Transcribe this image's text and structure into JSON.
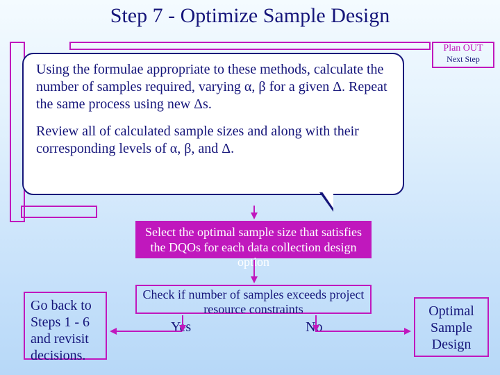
{
  "title": "Step 7 - Optimize Sample Design",
  "plan_out": {
    "label": "Plan OUT",
    "sublabel": "Next Step"
  },
  "callout": {
    "p1": "Using the formulae appropriate to these methods, calculate the number of samples required, varying α, β for a given Δ. Repeat the same process using new Δs.",
    "p2": "Review all of calculated sample sizes and along with their corresponding levels of  α, β, and Δ."
  },
  "select_box": "Select the optimal sample size that satisfies the DQOs for each data collection design option",
  "check_box": "Check if number of samples exceeds project resource constraints",
  "yes": "Yes",
  "no": "No",
  "go_back": "Go back to Steps 1 - 6 and revisit decisions.",
  "optimal": "Optimal Sample Design"
}
